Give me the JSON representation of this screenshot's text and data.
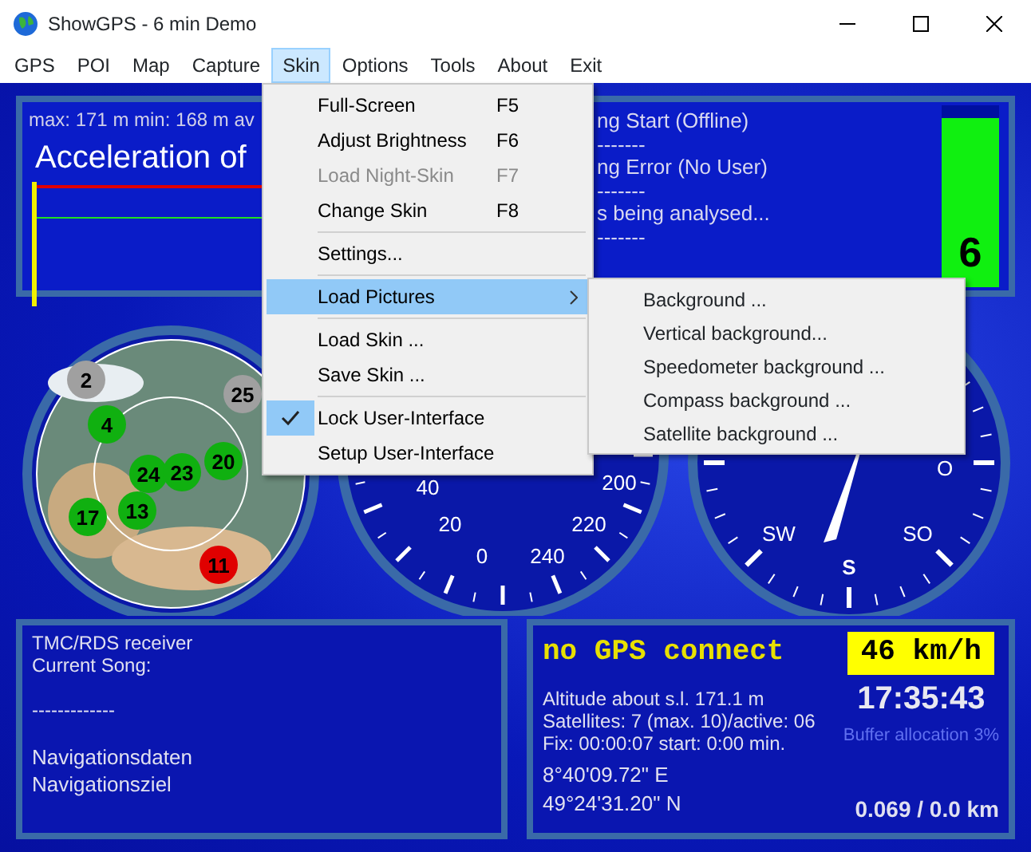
{
  "window": {
    "title": "ShowGPS - 6 min Demo"
  },
  "menu_bar": [
    {
      "label": "GPS",
      "selected": false
    },
    {
      "label": "POI",
      "selected": false
    },
    {
      "label": "Map",
      "selected": false
    },
    {
      "label": "Capture",
      "selected": false
    },
    {
      "label": "Skin",
      "selected": true
    },
    {
      "label": "Options",
      "selected": false
    },
    {
      "label": "Tools",
      "selected": false
    },
    {
      "label": "About",
      "selected": false
    },
    {
      "label": "Exit",
      "selected": false
    }
  ],
  "skin_menu": [
    {
      "kind": "item",
      "label": "Full-Screen",
      "shortcut": "F5",
      "disabled": false,
      "checked": false,
      "submenu": false,
      "selected": false
    },
    {
      "kind": "item",
      "label": "Adjust Brightness",
      "shortcut": "F6",
      "disabled": false,
      "checked": false,
      "submenu": false,
      "selected": false
    },
    {
      "kind": "item",
      "label": "Load Night-Skin",
      "shortcut": "F7",
      "disabled": true,
      "checked": false,
      "submenu": false,
      "selected": false
    },
    {
      "kind": "item",
      "label": "Change Skin",
      "shortcut": "F8",
      "disabled": false,
      "checked": false,
      "submenu": false,
      "selected": false
    },
    {
      "kind": "separator"
    },
    {
      "kind": "item",
      "label": "Settings...",
      "disabled": false,
      "checked": false,
      "submenu": false,
      "selected": false
    },
    {
      "kind": "separator"
    },
    {
      "kind": "item",
      "label": "Load Pictures",
      "disabled": false,
      "checked": false,
      "submenu": true,
      "selected": true
    },
    {
      "kind": "separator"
    },
    {
      "kind": "item",
      "label": "Load Skin ...",
      "disabled": false,
      "checked": false,
      "submenu": false,
      "selected": false
    },
    {
      "kind": "item",
      "label": "Save Skin ...",
      "disabled": false,
      "checked": false,
      "submenu": false,
      "selected": false
    },
    {
      "kind": "separator"
    },
    {
      "kind": "item",
      "label": "Lock User-Interface",
      "disabled": false,
      "checked": true,
      "submenu": false,
      "selected": false
    },
    {
      "kind": "item",
      "label": "Setup User-Interface",
      "disabled": false,
      "checked": false,
      "submenu": false,
      "selected": false
    }
  ],
  "load_pictures_submenu": [
    "Background ...",
    "Vertical background...",
    "Speedometer background ...",
    "Compass background ...",
    "Satellite background ..."
  ],
  "top_panel": {
    "stats": "max: 171 m min: 168 m av",
    "graph_title": "Acceleration of",
    "log_lines": [
      "ng Start (Offline)",
      "-------",
      "ng Error (No User)",
      "-------",
      "s being analysed...",
      "-------"
    ],
    "signal_bar": {
      "value": "6",
      "level": 0.93
    }
  },
  "satellites": [
    {
      "label": "2",
      "color": "#a0a0a0"
    },
    {
      "label": "25",
      "color": "#a0a0a0"
    },
    {
      "label": "4",
      "color": "#10b010"
    },
    {
      "label": "20",
      "color": "#10b010"
    },
    {
      "label": "24",
      "color": "#10b010"
    },
    {
      "label": "23",
      "color": "#10b010"
    },
    {
      "label": "13",
      "color": "#10b010"
    },
    {
      "label": "17",
      "color": "#10b010"
    },
    {
      "label": "11",
      "color": "#e00000"
    }
  ],
  "speedometer": {
    "labels": [
      "40",
      "20",
      "0",
      "240",
      "220",
      "200"
    ]
  },
  "compass": {
    "labels": [
      "O",
      "SW",
      "S",
      "SO"
    ]
  },
  "tmc_panel": {
    "receiver_lines": [
      "TMC/RDS receiver",
      "Current Song:"
    ],
    "divider": "-------------",
    "navigation_lines": [
      "Navigationsdaten",
      "Navigationsziel"
    ]
  },
  "gps_panel": {
    "status": "no GPS connect",
    "speed": "46 km/h",
    "time": "17:35:43",
    "buffer": "Buffer allocation 3%",
    "info": [
      "Altitude about s.l. 171.1 m",
      "Satellites: 7 (max. 10)/active: 06",
      "Fix: 00:00:07 start: 0:00 min."
    ],
    "coords": [
      "8°40'09.72\" E",
      "49°24'31.20\" N"
    ],
    "distance": "0.069 / 0.0 km"
  }
}
